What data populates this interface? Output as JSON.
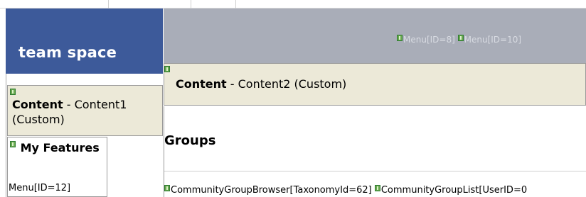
{
  "banner": {
    "title": "team space",
    "bg": "#3d5a9a"
  },
  "header": {
    "menu_items": [
      "Menu[ID=8]",
      "Menu[ID=10]"
    ],
    "bg": "#a9adb8"
  },
  "content1": {
    "name": "Content",
    "rest": " - Content1 (Custom)"
  },
  "features": {
    "title": "My Features",
    "menu": "Menu[ID=12]"
  },
  "content2": {
    "name": "Content",
    "rest": " - Content2 (Custom)"
  },
  "groups": {
    "title": "Groups",
    "controls": [
      "CommunityGroupBrowser[TaxonomyId=62]",
      "CommunityGroupList[UserID=0"
    ]
  },
  "colors": {
    "panel": "#ece9d8",
    "marker": "#6aa84f"
  }
}
